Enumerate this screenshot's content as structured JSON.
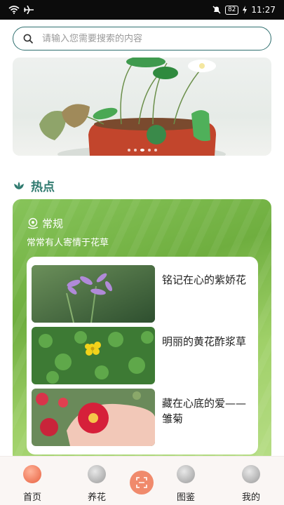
{
  "status": {
    "time": "11:27",
    "battery": "82"
  },
  "search": {
    "placeholder": "请输入您需要搜索的内容"
  },
  "section": {
    "title": "热点"
  },
  "card": {
    "heading": "常规",
    "subtitle": "常常有人寄情于花草",
    "items": [
      {
        "title": "铭记在心的紫娇花"
      },
      {
        "title": "明丽的黄花酢浆草"
      },
      {
        "title": "藏在心底的爱——雏菊"
      }
    ]
  },
  "tabbar": {
    "tabs": [
      {
        "label": "首页"
      },
      {
        "label": "养花"
      },
      {
        "label": "图鉴"
      },
      {
        "label": "我的"
      }
    ]
  },
  "colors": {
    "accent": "#2f7a6f",
    "card_green": "#7cbc4c",
    "center_button": "#f08a6c"
  }
}
